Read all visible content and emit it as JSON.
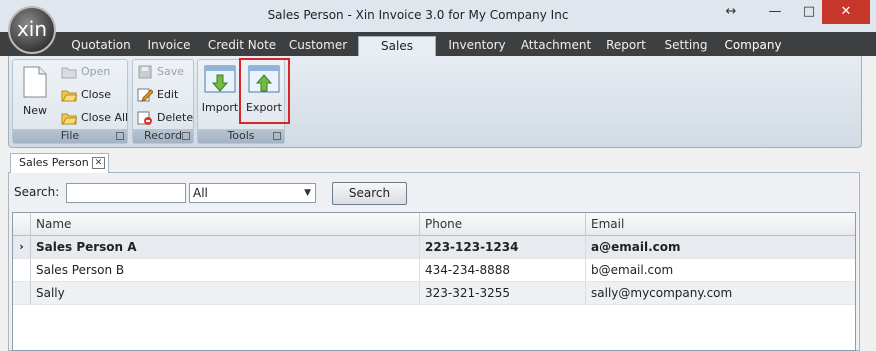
{
  "window": {
    "title": "Sales Person - Xin Invoice 3.0 for My Company Inc",
    "logo_text": "xin",
    "controls": {
      "resize": "↔",
      "minimize": "—",
      "maximize": "□",
      "close": "✕"
    }
  },
  "menu_tabs": [
    {
      "label": "Quotation"
    },
    {
      "label": "Invoice"
    },
    {
      "label": "Credit Note"
    },
    {
      "label": "Customer"
    },
    {
      "label": "Sales Person"
    },
    {
      "label": "Inventory"
    },
    {
      "label": "Attachment"
    },
    {
      "label": "Report"
    },
    {
      "label": "Setting"
    },
    {
      "label": "Company"
    }
  ],
  "ribbon": {
    "file_group": {
      "title": "File",
      "new_label": "New",
      "open_label": "Open",
      "close_label": "Close",
      "close_all_label": "Close All"
    },
    "record_group": {
      "title": "Record",
      "save_label": "Save",
      "edit_label": "Edit",
      "delete_label": "Delete"
    },
    "tools_group": {
      "title": "Tools",
      "import_label": "Import",
      "export_label": "Export"
    }
  },
  "document_tab": {
    "label": "Sales Person",
    "close": "✕"
  },
  "search": {
    "label": "Search:",
    "input_value": "",
    "filter_selected": "All",
    "button_label": "Search"
  },
  "grid": {
    "columns": [
      "Name",
      "Phone",
      "Email"
    ],
    "rows": [
      {
        "name": "Sales Person A",
        "phone": "223-123-1234",
        "email": "a@email.com"
      },
      {
        "name": "Sales Person B",
        "phone": "434-234-8888",
        "email": "b@email.com"
      },
      {
        "name": "Sally",
        "phone": "323-321-3255",
        "email": "sally@mycompany.com"
      }
    ],
    "selected_indicator": "›"
  }
}
